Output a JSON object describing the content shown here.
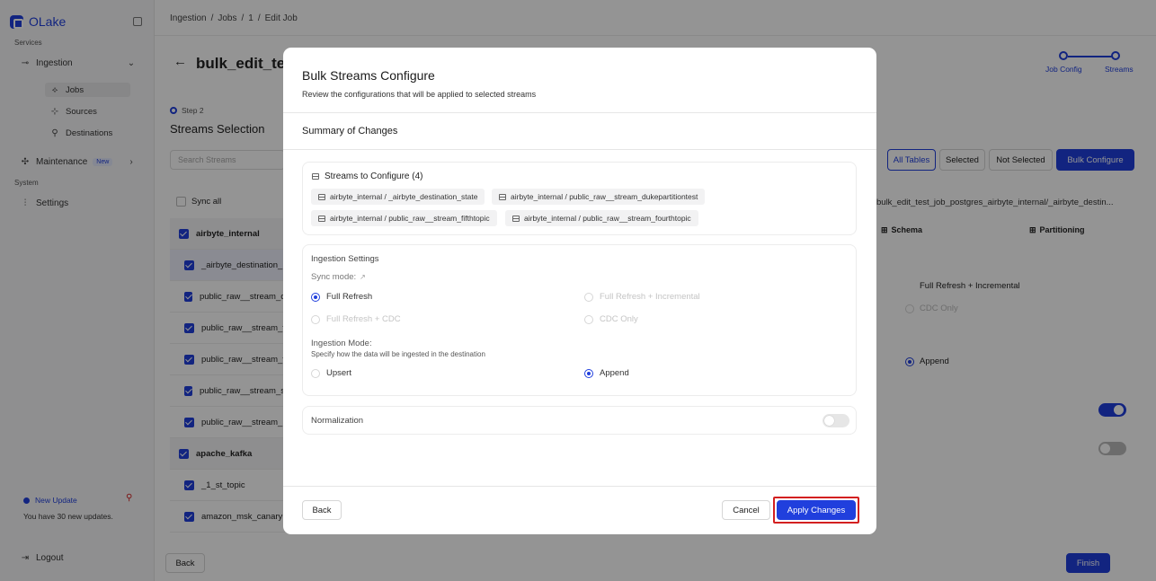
{
  "app": {
    "name": "OLake"
  },
  "sidebar": {
    "services_label": "Services",
    "ingestion_label": "Ingestion",
    "jobs_label": "Jobs",
    "sources_label": "Sources",
    "destinations_label": "Destinations",
    "maintenance_label": "Maintenance",
    "maintenance_badge": "New",
    "system_label": "System",
    "settings_label": "Settings",
    "update_title": "New Update",
    "update_text": "You have 30 new updates.",
    "logout_label": "Logout"
  },
  "breadcrumb": {
    "items": [
      "Ingestion",
      "/",
      "Jobs",
      "/",
      "1",
      "/",
      "Edit Job"
    ]
  },
  "page": {
    "title": "bulk_edit_tes",
    "step_label": "Step 2",
    "section_title": "Streams Selection",
    "search_placeholder": "Search Streams",
    "sync_all_label": "Sync all",
    "back_label": "Back",
    "finish_label": "Finish"
  },
  "stepper": {
    "step1": "Job Config",
    "step2": "Streams"
  },
  "filters": {
    "all": "All Tables",
    "selected": "Selected",
    "not_selected": "Not Selected",
    "bulk": "Bulk Configure"
  },
  "stream_list": {
    "groups": [
      {
        "name": "airbyte_internal",
        "items": [
          "_airbyte_destination_",
          "public_raw__stream_c",
          "public_raw__stream_f",
          "public_raw__stream_f",
          "public_raw__stream_s",
          "public_raw__stream_"
        ]
      },
      {
        "name": "apache_kafka",
        "items": [
          "_1_st_topic",
          "amazon_msk_canary"
        ]
      }
    ]
  },
  "detail_panel": {
    "stream_path": "bulk_edit_test_job_postgres_airbyte_internal/_airbyte_destin...",
    "schema_tab": "Schema",
    "partitioning_tab": "Partitioning",
    "full_incremental": "Full Refresh + Incremental",
    "cdc_only": "CDC Only",
    "append": "Append"
  },
  "modal": {
    "title": "Bulk Streams Configure",
    "subtitle": "Review the configurations that will be applied to selected streams",
    "summary_title": "Summary of Changes",
    "streams_header": "Streams to Configure (4)",
    "streams": [
      "airbyte_internal / _airbyte_destination_state",
      "airbyte_internal / public_raw__stream_dukepartitiontest",
      "airbyte_internal / public_raw__stream_fifthtopic",
      "airbyte_internal / public_raw__stream_fourthtopic"
    ],
    "ingestion_settings_title": "Ingestion Settings",
    "sync_mode_label": "Sync mode:",
    "sync_options": [
      "Full Refresh",
      "Full Refresh + Incremental",
      "Full Refresh + CDC",
      "CDC Only"
    ],
    "sync_selected": "Full Refresh",
    "ingestion_mode_label": "Ingestion Mode:",
    "ingestion_mode_desc": "Specify how the data will be ingested in the destination",
    "ingestion_options": [
      "Upsert",
      "Append"
    ],
    "ingestion_selected": "Append",
    "normalization_label": "Normalization",
    "normalization_on": false,
    "back_label": "Back",
    "cancel_label": "Cancel",
    "apply_label": "Apply Changes"
  },
  "colors": {
    "accent": "#203fdd",
    "highlight": "#d32020"
  }
}
